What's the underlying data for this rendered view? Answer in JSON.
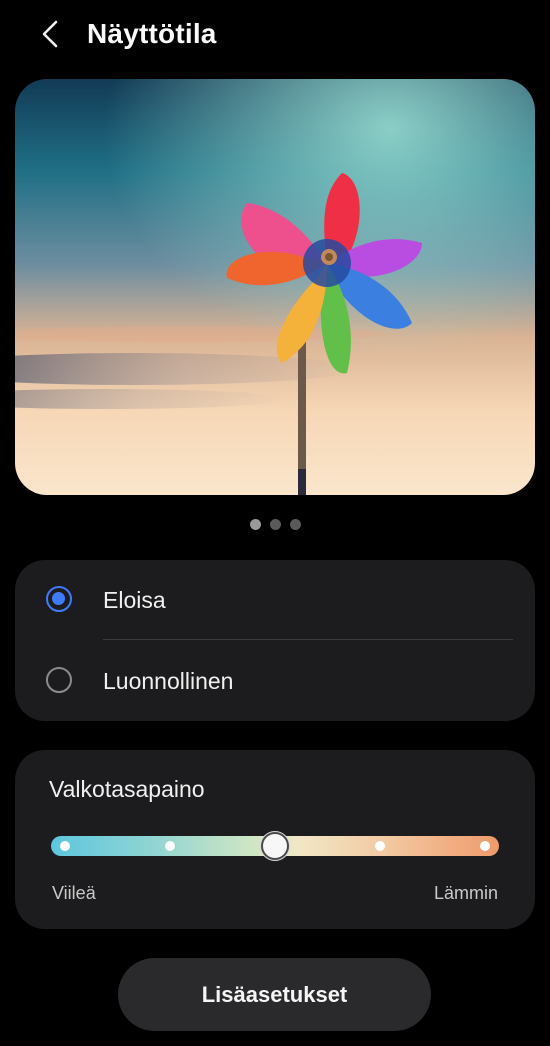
{
  "header": {
    "title": "Näyttötila"
  },
  "preview": {
    "image": "pinwheel-photo",
    "page_count": 3,
    "active_page": 0
  },
  "mode": {
    "options": [
      {
        "label": "Eloisa",
        "selected": true
      },
      {
        "label": "Luonnollinen",
        "selected": false
      }
    ]
  },
  "white_balance": {
    "title": "Valkotasapaino",
    "left_label": "Viileä",
    "right_label": "Lämmin",
    "steps": 5,
    "value": 0.5
  },
  "advanced": {
    "label": "Lisäasetukset"
  },
  "colors": {
    "accent": "#3e7bfa",
    "card": "#1c1c1e",
    "background": "#000000"
  },
  "icons": {
    "back": "chevron-left-icon"
  }
}
